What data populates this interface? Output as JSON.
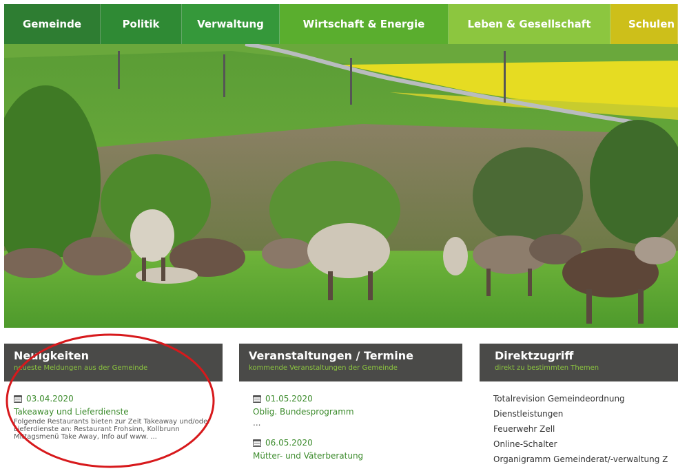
{
  "nav": {
    "items": [
      {
        "label": "Gemeinde",
        "color": "#2e7d32"
      },
      {
        "label": "Politik",
        "color": "#2f8a34"
      },
      {
        "label": "Verwaltung",
        "color": "#35983a"
      },
      {
        "label": "Wirtschaft & Energie",
        "color": "#5aae2e"
      },
      {
        "label": "Leben & Gesellschaft",
        "color": "#8cc63f"
      },
      {
        "label": "Schulen",
        "color": "#cdbf1a"
      }
    ]
  },
  "panels": {
    "news": {
      "title": "Neuigkeiten",
      "subtitle": "neueste Meldungen aus der Gemeinde",
      "entries": [
        {
          "icon": "calendar-icon",
          "date": "03.04.2020",
          "title": "Takeaway und Lieferdienste",
          "text": "Folgende Restaurants bieten zur Zeit Takeaway und/oder Lieferdienste an: Restaurant Frohsinn, Kollbrunn Mittagsmenü Take Away, Info auf www. ..."
        }
      ]
    },
    "events": {
      "title": "Veranstaltungen / Termine",
      "subtitle": "kommende Veranstaltungen der Gemeinde",
      "entries": [
        {
          "icon": "calendar-icon",
          "date": "01.05.2020",
          "title": "Oblig. Bundesprogramm",
          "text": "..."
        },
        {
          "icon": "calendar-icon",
          "date": "06.05.2020",
          "title": "Mütter- und Väterberatung"
        }
      ]
    },
    "quick": {
      "title": "Direktzugriff",
      "subtitle": "direkt zu bestimmten Themen",
      "items": [
        "Totalrevision Gemeindeordnung",
        "Dienstleistungen",
        "Feuerwehr Zell",
        "Online-Schalter",
        "Organigramm Gemeinderat/-verwaltung Z"
      ]
    }
  },
  "hero": {
    "alt": "cows-on-meadow-photo"
  },
  "colors": {
    "header_bg": "#4a4a48",
    "accent_green": "#3a8a2a",
    "annotation_red": "#d7191c"
  }
}
